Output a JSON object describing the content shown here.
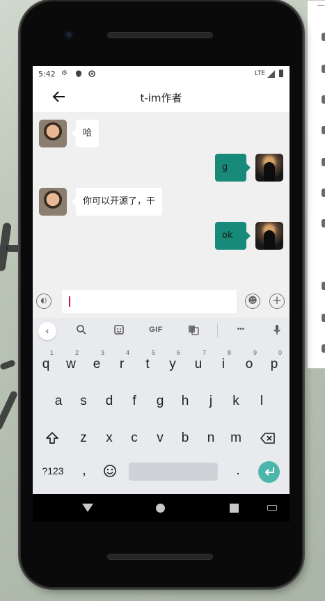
{
  "status_bar": {
    "time": "5:42",
    "network": "LTE",
    "icons": [
      "gear-icon",
      "shield-icon",
      "sync-icon",
      "signal-icon",
      "battery-icon"
    ]
  },
  "app_bar": {
    "title": "t-im作者",
    "back_icon": "arrow-left-icon"
  },
  "messages": [
    {
      "side": "left",
      "text": "哈"
    },
    {
      "side": "right",
      "text": "g"
    },
    {
      "side": "left",
      "text": "你可以开源了，干"
    },
    {
      "side": "right",
      "text": "ok"
    }
  ],
  "input_bar": {
    "value": "",
    "placeholder": "",
    "icons": [
      "voice-icon",
      "emoji-icon",
      "plus-icon"
    ]
  },
  "keyboard": {
    "suggestions": {
      "gif_label": "GIF",
      "more": "•••"
    },
    "row1": [
      {
        "key": "q",
        "hint": "1"
      },
      {
        "key": "w",
        "hint": "2"
      },
      {
        "key": "e",
        "hint": "3"
      },
      {
        "key": "r",
        "hint": "4"
      },
      {
        "key": "t",
        "hint": "5"
      },
      {
        "key": "y",
        "hint": "6"
      },
      {
        "key": "u",
        "hint": "7"
      },
      {
        "key": "i",
        "hint": "8"
      },
      {
        "key": "o",
        "hint": "9"
      },
      {
        "key": "p",
        "hint": "0"
      }
    ],
    "row2": [
      "a",
      "s",
      "d",
      "f",
      "g",
      "h",
      "j",
      "k",
      "l"
    ],
    "row3": [
      "z",
      "x",
      "c",
      "v",
      "b",
      "n",
      "m"
    ],
    "row4": {
      "symbols": "?123",
      "comma": ",",
      "period": "."
    }
  },
  "colors": {
    "accent": "#178a7a",
    "enter_key": "#4db6ac",
    "cursor": "#c2185b"
  }
}
